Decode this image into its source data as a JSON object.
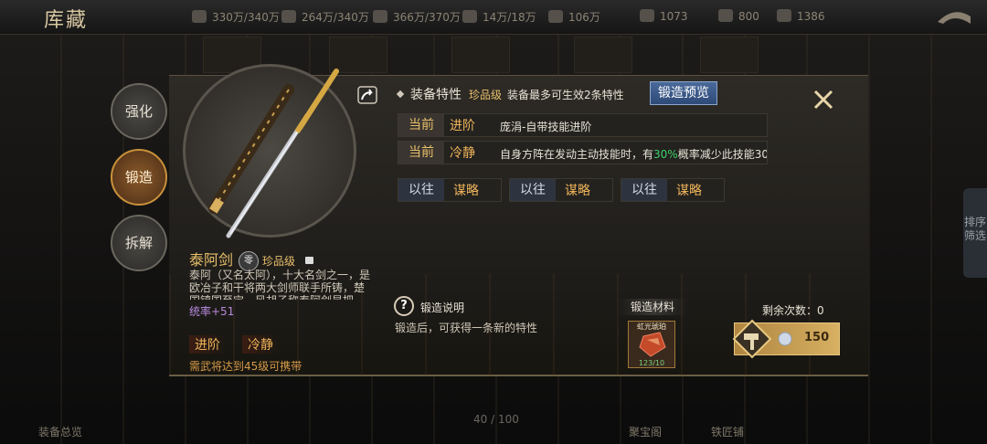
{
  "topbar": {
    "title": "库藏",
    "resources": [
      {
        "icon": "horse-icon",
        "value": "330万/340万"
      },
      {
        "icon": "scroll-icon",
        "value": "264万/340万"
      },
      {
        "icon": "grain-icon",
        "value": "366万/370万"
      },
      {
        "icon": "ingot-icon",
        "value": "14万/18万"
      },
      {
        "icon": "blade-icon",
        "value": "106万"
      },
      {
        "icon": "coin-icon",
        "value": "1073"
      },
      {
        "icon": "gold-icon",
        "value": "800"
      },
      {
        "icon": "silver-icon",
        "value": "1386"
      }
    ]
  },
  "left_tabs": [
    {
      "label": "强化"
    },
    {
      "label": "锻造"
    },
    {
      "label": "拆解"
    }
  ],
  "equipment": {
    "name": "泰阿剑",
    "badge": "零",
    "quality": "珍品级",
    "description": "泰阿（又名太阿），十大名剑之一，是欧冶子和干将两大剑师联手所铸，楚国镇国至宝，风胡子称泰阿剑是把",
    "stat": "统率+51",
    "traits": [
      "进阶",
      "冷静"
    ],
    "requirement": "需武将达到45级可携带"
  },
  "features": {
    "title": "装备特性",
    "quality": "珍品级",
    "note": "装备最多可生效2条特性",
    "preview_button": "锻造预览",
    "current_rows": [
      {
        "label": "当前",
        "trait": "进阶",
        "text_before": "庞涓-自带技能进阶",
        "highlight": "",
        "text_after": ""
      },
      {
        "label": "当前",
        "trait": "冷静",
        "text_before": "自身方阵在发动主动技能时，有",
        "highlight": "30%",
        "text_after": "概率减少此技能30"
      }
    ],
    "past_rows": [
      {
        "label": "以往",
        "trait": "谋略"
      },
      {
        "label": "以往",
        "trait": "谋略"
      },
      {
        "label": "以往",
        "trait": "谋略"
      }
    ]
  },
  "forge": {
    "help_title": "锻造说明",
    "help_text": "锻造后，可获得一条新的特性",
    "materials_title": "锻造材料",
    "material": {
      "name": "虹光琥珀",
      "count": "123/10"
    },
    "remaining_label": "剩余次数：0",
    "cost": "150"
  },
  "bottombar": {
    "overview": "装备总览",
    "page_count": "40 / 100",
    "treasure": "聚宝阁",
    "smith": "铁匠铺"
  },
  "side_tab": "排序筛选",
  "colors": {
    "accent_gold": "#e7bf6a",
    "highlight_green": "#3fd06a",
    "stat_purple": "#b88ae0",
    "button_blue": "#2e4a78"
  }
}
